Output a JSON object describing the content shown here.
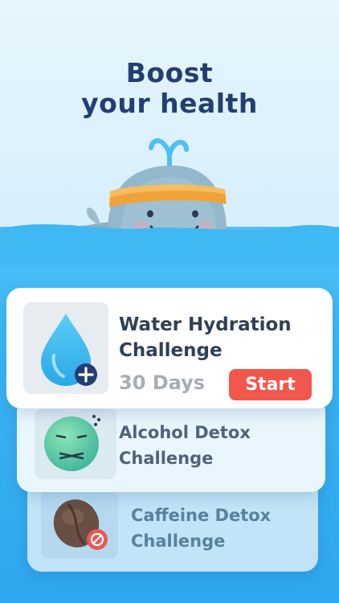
{
  "headline": {
    "line1": "Boost",
    "line2": "your health"
  },
  "challenges": [
    {
      "title_line1": "Water Hydration",
      "title_line2": "Challenge",
      "duration": "30 Days",
      "action": "Start"
    },
    {
      "title_line1": "Alcohol Detox",
      "title_line2": "Challenge"
    },
    {
      "title_line1": "Caffeine Detox",
      "title_line2": "Challenge"
    }
  ],
  "colors": {
    "headline": "#233e73",
    "sea": "#39b3f2",
    "start_button": "#f2574d",
    "headband": "#f0a23a",
    "whale": "#8fb3c8"
  }
}
